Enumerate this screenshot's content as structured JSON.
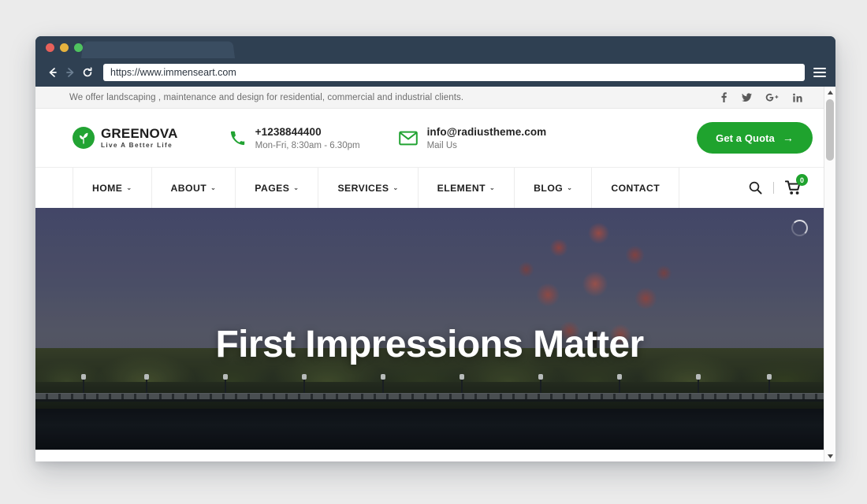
{
  "browser": {
    "url": "https://www.immenseart.com",
    "back_icon": "back-arrow-icon",
    "forward_icon": "forward-arrow-icon",
    "reload_icon": "reload-icon",
    "menu_icon": "hamburger-menu-icon"
  },
  "topbar": {
    "message": "We offer landscaping , maintenance and design for residential, commercial and industrial clients.",
    "social": [
      {
        "name": "facebook-icon",
        "label": "f"
      },
      {
        "name": "twitter-icon",
        "label": "t"
      },
      {
        "name": "google-plus-icon",
        "label": "G+"
      },
      {
        "name": "linkedin-icon",
        "label": "in"
      }
    ]
  },
  "header": {
    "logo": {
      "name": "GREENOVA",
      "tagline": "Live A Better Life",
      "mark_color": "#22a333"
    },
    "phone": {
      "number": "+1238844400",
      "hours": "Mon-Fri, 8:30am - 6.30pm",
      "icon": "phone-icon"
    },
    "email": {
      "address": "info@radiustheme.com",
      "label": "Mail Us",
      "icon": "envelope-icon"
    },
    "cta": {
      "label": "Get a Quota",
      "arrow": "→",
      "color": "#1fa32e"
    }
  },
  "nav": {
    "items": [
      {
        "label": "HOME",
        "has_dropdown": true
      },
      {
        "label": "ABOUT",
        "has_dropdown": true
      },
      {
        "label": "PAGES",
        "has_dropdown": true
      },
      {
        "label": "SERVICES",
        "has_dropdown": true
      },
      {
        "label": "ELEMENT",
        "has_dropdown": true
      },
      {
        "label": "BLOG",
        "has_dropdown": true
      },
      {
        "label": "CONTACT",
        "has_dropdown": false
      }
    ],
    "search_icon": "search-icon",
    "cart_icon": "shopping-cart-icon",
    "cart_count": "0",
    "badge_color": "#1fa32e"
  },
  "hero": {
    "title": "First Impressions Matter",
    "spinner": "loading-spinner-icon",
    "image_description": "autumn tree by a lakeside boardwalk at dusk"
  },
  "chevron": "⌄"
}
